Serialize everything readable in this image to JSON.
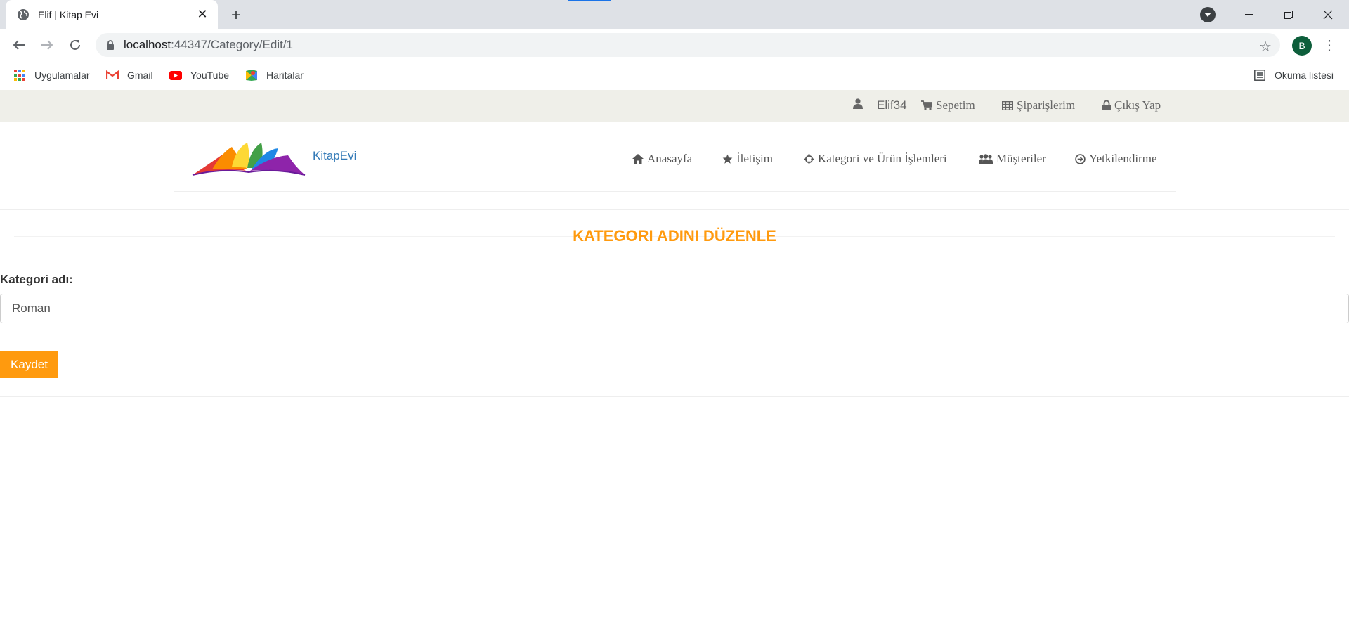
{
  "browser": {
    "tab_title": "Elif | Kitap Evi",
    "url_host": "localhost",
    "url_rest": ":44347/Category/Edit/1",
    "profile_initial": "B",
    "bookmarks": [
      {
        "label": "Uygulamalar",
        "icon": "apps-grid-icon"
      },
      {
        "label": "Gmail",
        "icon": "gmail-icon"
      },
      {
        "label": "YouTube",
        "icon": "youtube-icon"
      },
      {
        "label": "Haritalar",
        "icon": "maps-icon"
      }
    ],
    "reading_list": "Okuma listesi"
  },
  "topbar": {
    "user": "Elif34",
    "cart": "Sepetim",
    "orders": "Şiparişlerim",
    "logout": "Çıkış Yap"
  },
  "header": {
    "brand": "KitapEvi",
    "nav": {
      "home": "Anasayfa",
      "contact": "İletişim",
      "category_product": "Kategori ve Ürün İşlemleri",
      "customers": "Müşteriler",
      "authorization": "Yetkilendirme"
    }
  },
  "form": {
    "title": "KATEGORI ADINI DÜZENLE",
    "label": "Kategori adı:",
    "value": "Roman",
    "submit": "Kaydet"
  },
  "colors": {
    "accent": "#ff9a0e",
    "brand_link": "#337ab7",
    "topbar_bg": "#efefe9"
  }
}
